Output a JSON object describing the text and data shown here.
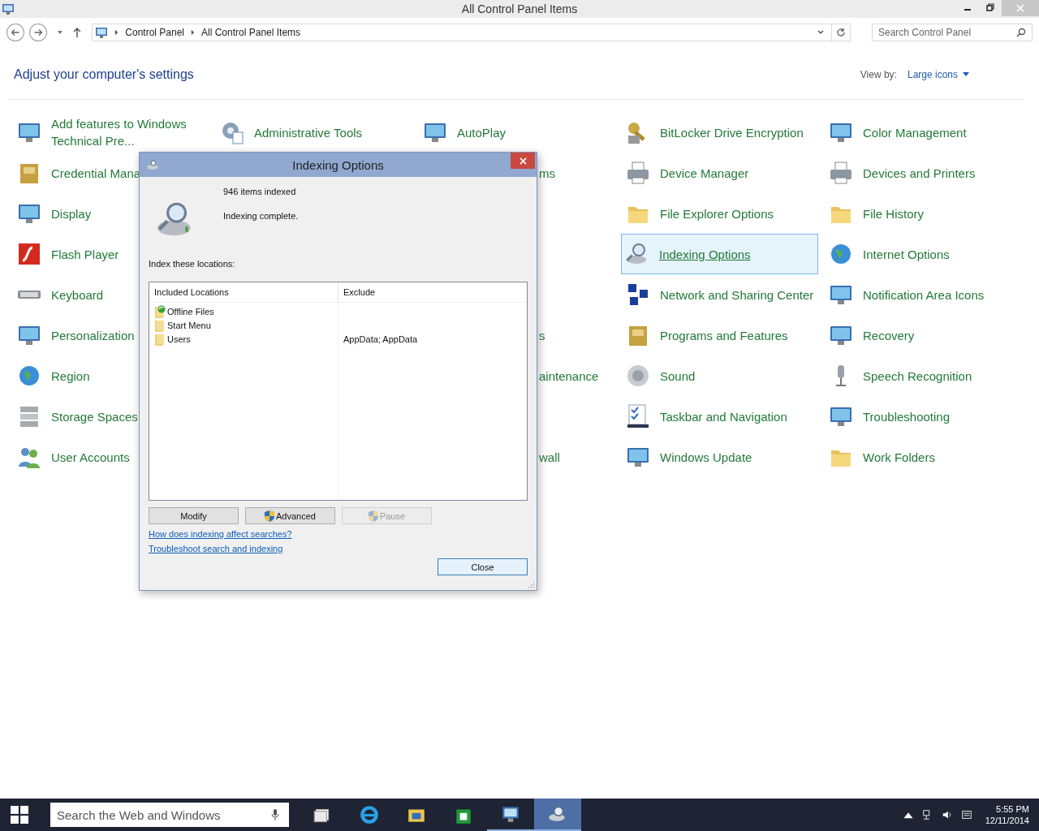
{
  "window": {
    "title": "All Control Panel Items",
    "address": [
      "Control Panel",
      "All Control Panel Items"
    ],
    "search": {
      "placeholder": "Search Control Panel"
    }
  },
  "heading": "Adjust your computer's settings",
  "view_by": {
    "label": "View by:",
    "value": "Large icons"
  },
  "rows": [
    {
      "cells": [
        {
          "kind": "item",
          "label": "Add features to Windows Technical Pre...",
          "selected": false
        },
        {
          "kind": "item",
          "label": "Administrative Tools",
          "selected": false
        },
        {
          "kind": "item",
          "label": "AutoPlay",
          "selected": false
        },
        {
          "kind": "item",
          "label": "BitLocker Drive Encryption",
          "selected": false
        },
        {
          "kind": "item",
          "label": "Color Management",
          "selected": false
        }
      ]
    },
    {
      "cells": [
        {
          "kind": "item",
          "label": "Credential Mana",
          "selected": false
        },
        {
          "kind": "covered"
        },
        {
          "kind": "partial",
          "label": "ms"
        },
        {
          "kind": "item",
          "label": "Device Manager",
          "selected": false
        },
        {
          "kind": "item",
          "label": "Devices and Printers",
          "selected": false
        }
      ]
    },
    {
      "cells": [
        {
          "kind": "item",
          "label": "Display",
          "selected": false
        },
        {
          "kind": "covered"
        },
        {
          "kind": "covered"
        },
        {
          "kind": "item",
          "label": "File Explorer Options",
          "selected": false
        },
        {
          "kind": "item",
          "label": "File History",
          "selected": false
        }
      ]
    },
    {
      "cells": [
        {
          "kind": "item",
          "label": "Flash Player",
          "selected": false
        },
        {
          "kind": "covered"
        },
        {
          "kind": "covered"
        },
        {
          "kind": "item",
          "label": "Indexing Options",
          "selected": true
        },
        {
          "kind": "item",
          "label": "Internet Options",
          "selected": false
        }
      ]
    },
    {
      "cells": [
        {
          "kind": "item",
          "label": "Keyboard",
          "selected": false
        },
        {
          "kind": "covered"
        },
        {
          "kind": "covered"
        },
        {
          "kind": "item",
          "label": "Network and Sharing Center",
          "selected": false
        },
        {
          "kind": "item",
          "label": "Notification Area Icons",
          "selected": false
        }
      ]
    },
    {
      "cells": [
        {
          "kind": "item",
          "label": "Personalization",
          "selected": false
        },
        {
          "kind": "covered"
        },
        {
          "kind": "partial",
          "label": "s"
        },
        {
          "kind": "item",
          "label": "Programs and Features",
          "selected": false
        },
        {
          "kind": "item",
          "label": "Recovery",
          "selected": false
        }
      ]
    },
    {
      "cells": [
        {
          "kind": "item",
          "label": "Region",
          "selected": false
        },
        {
          "kind": "covered"
        },
        {
          "kind": "partial",
          "label": "aintenance"
        },
        {
          "kind": "item",
          "label": "Sound",
          "selected": false
        },
        {
          "kind": "item",
          "label": "Speech Recognition",
          "selected": false
        }
      ]
    },
    {
      "cells": [
        {
          "kind": "item",
          "label": "Storage Spaces",
          "selected": false
        },
        {
          "kind": "covered"
        },
        {
          "kind": "covered"
        },
        {
          "kind": "item",
          "label": "Taskbar and Navigation",
          "selected": false
        },
        {
          "kind": "item",
          "label": "Troubleshooting",
          "selected": false
        }
      ]
    },
    {
      "cells": [
        {
          "kind": "item",
          "label": "User Accounts",
          "selected": false
        },
        {
          "kind": "covered"
        },
        {
          "kind": "partial",
          "label": "wall"
        },
        {
          "kind": "item",
          "label": "Windows Update",
          "selected": false
        },
        {
          "kind": "item",
          "label": "Work Folders",
          "selected": false
        }
      ]
    }
  ],
  "dialog": {
    "title": "Indexing Options",
    "count": "946 items indexed",
    "status": "Indexing complete.",
    "locations_label": "Index these locations:",
    "columns": [
      "Included Locations",
      "Exclude"
    ],
    "locations": [
      {
        "name": "Offline Files",
        "kind": "synced"
      },
      {
        "name": "Start Menu",
        "kind": "folder"
      },
      {
        "name": "Users",
        "kind": "folder",
        "exclude": "AppData; AppData"
      }
    ],
    "buttons": [
      {
        "label": "Modify",
        "shield": false,
        "disabled": false
      },
      {
        "label": "Advanced",
        "shield": true,
        "disabled": false
      },
      {
        "label": "Pause",
        "shield": true,
        "disabled": true
      }
    ],
    "links": [
      "How does indexing affect searches?",
      "Troubleshoot search and indexing"
    ],
    "close": "Close"
  },
  "taskbar": {
    "search_placeholder": "Search the Web and Windows",
    "apps": [
      {
        "running": false,
        "selected": false
      },
      {
        "running": false,
        "selected": false
      },
      {
        "running": false,
        "selected": false
      },
      {
        "running": false,
        "selected": false
      },
      {
        "running": true,
        "selected": false
      },
      {
        "running": true,
        "selected": true
      }
    ],
    "time": "5:55 PM",
    "date": "12/11/2014"
  }
}
